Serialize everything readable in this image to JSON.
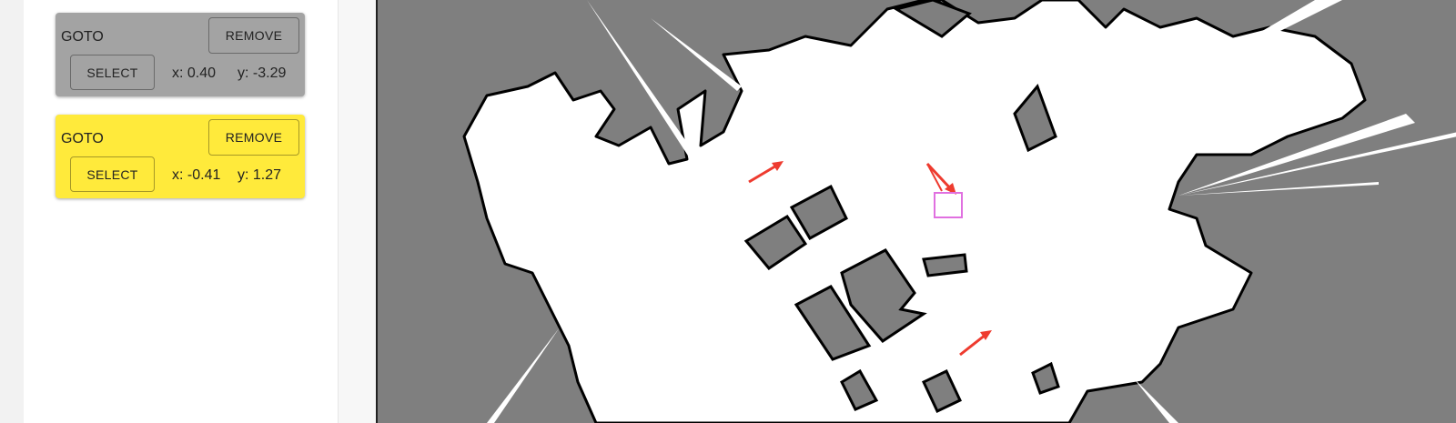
{
  "waypoints": [
    {
      "title": "GOTO",
      "remove_label": "REMOVE",
      "select_label": "SELECT",
      "x_text": "x: 0.40",
      "y_text": "y: -3.29",
      "bg_color": "#a3a3a3"
    },
    {
      "title": "GOTO",
      "remove_label": "REMOVE",
      "select_label": "SELECT",
      "x_text": "x: -0.41",
      "y_text": "y: 1.27",
      "bg_color": "#ffea3b"
    }
  ],
  "map": {
    "unknown_color": "#7f7f7f",
    "free_color": "#ffffff",
    "occupied_color": "#000000",
    "goal_arrow_color": "#ee3b2f",
    "robot_marker_color": "#e070e0",
    "robot_marker_icon": "robot-position-icon",
    "goal_arrow_icon": "goal-arrow-icon"
  }
}
